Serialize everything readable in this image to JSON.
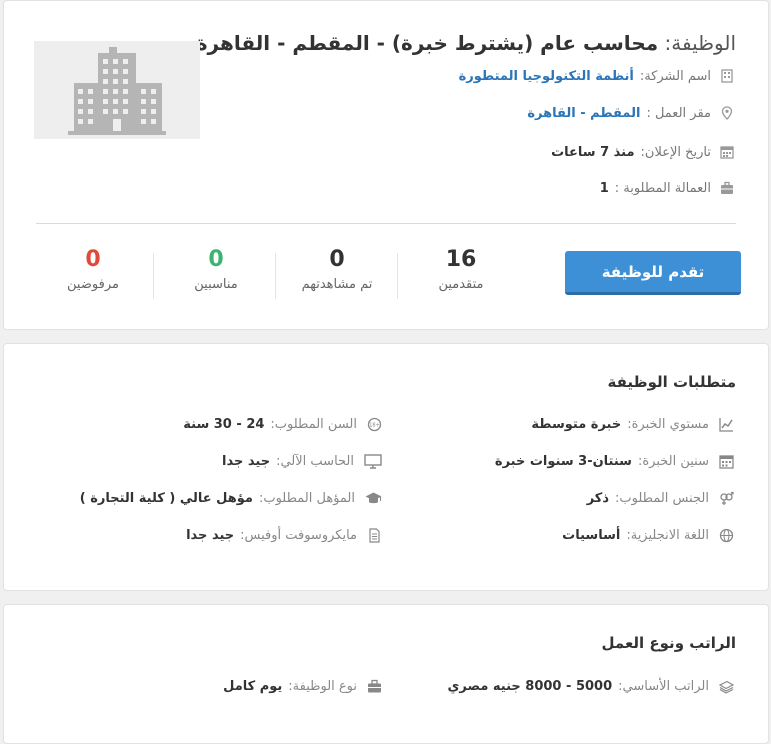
{
  "header": {
    "title_label": "الوظيفة:",
    "title_value": "محاسب عام (يشترط خبرة) - المقطم - القاهرة",
    "company_label": "اسم الشركة:",
    "company_value": "أنظمة التكنولوجيا المتطورة",
    "location_label": "مقر العمل :",
    "location_value": "المقطم - القاهرة",
    "posted_label": "تاريخ الإعلان:",
    "posted_value": "منذ 7 ساعات",
    "vacancies_label": "العمالة المطلوبة :",
    "vacancies_value": "1",
    "apply_button": "تقدم للوظيفة",
    "stats": [
      {
        "num": "16",
        "label": "متقدمين",
        "color": "#333333"
      },
      {
        "num": "0",
        "label": "تم مشاهدتهم",
        "color": "#333333"
      },
      {
        "num": "0",
        "label": "مناسبين",
        "color": "#3cb371"
      },
      {
        "num": "0",
        "label": "مرفوضين",
        "color": "#e04a3b"
      }
    ]
  },
  "requirements": {
    "title": "متطلبات الوظيفة",
    "items": [
      {
        "label": "مستوي الخبرة:",
        "value": "خبرة متوسطة",
        "icon": "chart-icon"
      },
      {
        "label": "السن المطلوب:",
        "value": "24 - 30 سنة",
        "icon": "age-icon"
      },
      {
        "label": "سنين الخبرة:",
        "value": "سنتان-3 سنوات خبرة",
        "icon": "calendar-icon"
      },
      {
        "label": "الحاسب الآلي:",
        "value": "جيد جدا",
        "icon": "monitor-icon"
      },
      {
        "label": "الجنس المطلوب:",
        "value": "ذكر",
        "icon": "gender-icon"
      },
      {
        "label": "المؤهل المطلوب:",
        "value": "مؤهل عالي ( كلية التجارة )",
        "icon": "graduation-cap-icon"
      },
      {
        "label": "اللغة الانجليزية:",
        "value": "أساسيات",
        "icon": "globe-icon"
      },
      {
        "label": "مايكروسوفت أوفيس:",
        "value": "جيد جدا",
        "icon": "document-icon"
      }
    ]
  },
  "salary": {
    "title": "الراتب ونوع العمل",
    "salary_label": "الراتب الأساسي:",
    "salary_value": "5000 - 8000 جنيه مصري",
    "type_label": "نوع الوظيفة:",
    "type_value": "يوم كامل"
  },
  "colors": {
    "accent": "#3d8fd6",
    "link": "#2a74b8",
    "green": "#3cb371",
    "red": "#e04a3b"
  }
}
